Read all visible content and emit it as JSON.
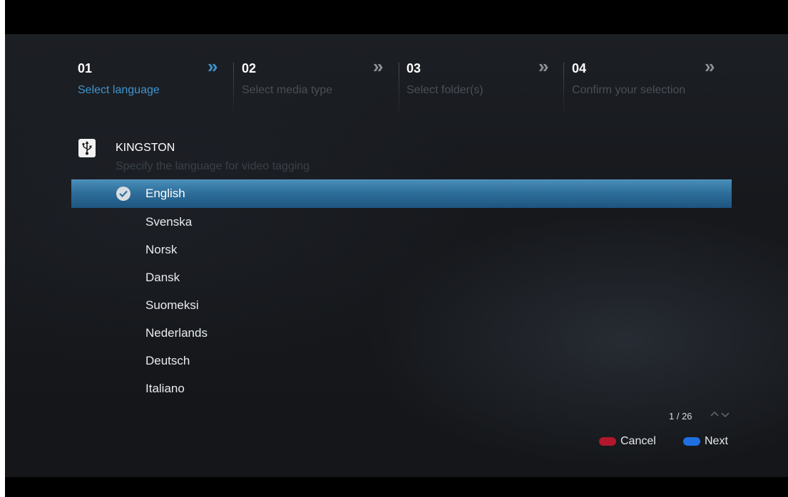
{
  "wizard": {
    "steps": [
      {
        "number": "01",
        "title": "Select language"
      },
      {
        "number": "02",
        "title": "Select media type"
      },
      {
        "number": "03",
        "title": "Select folder(s)"
      },
      {
        "number": "04",
        "title": "Confirm your selection"
      }
    ],
    "active_step": 1,
    "arrow_glyph": "»"
  },
  "device": {
    "icon": "usb-icon",
    "name": "KINGSTON",
    "subtitle": "Specify the language for video tagging"
  },
  "languages": {
    "selected_index": 0,
    "items": [
      "English",
      "Svenska",
      "Norsk",
      "Dansk",
      "Suomeksi",
      "Nederlands",
      "Deutsch",
      "Italiano"
    ]
  },
  "pager": {
    "text": "1 / 26"
  },
  "footer": {
    "cancel": {
      "label": "Cancel",
      "color": "#b2182b"
    },
    "next": {
      "label": "Next",
      "color": "#1f6fe0"
    }
  },
  "colors": {
    "accent": "#3f95cf",
    "selected_row": "#2f6f9b"
  }
}
